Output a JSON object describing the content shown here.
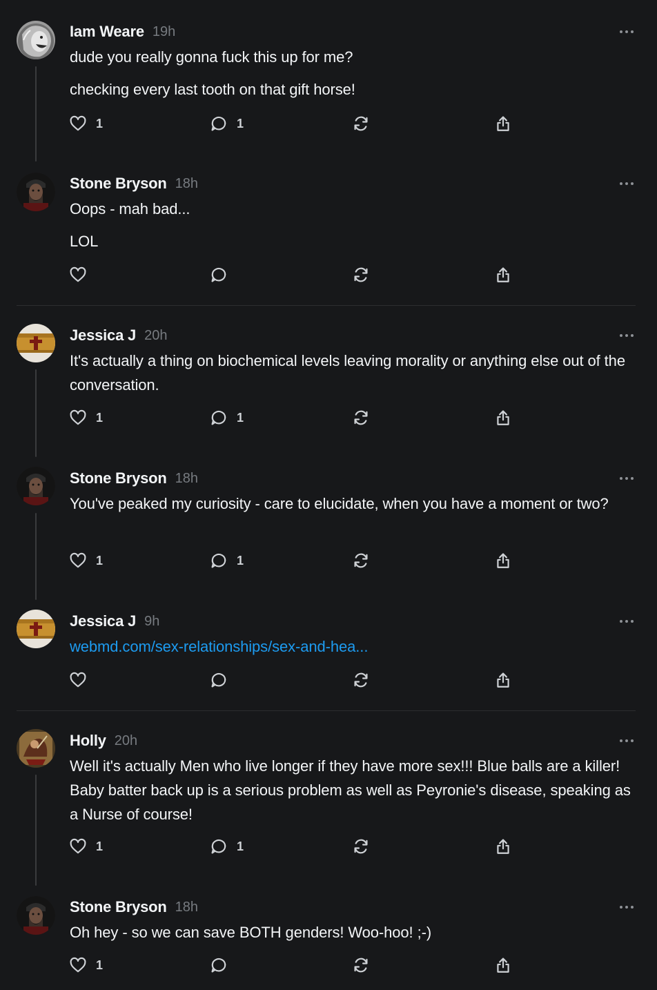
{
  "posts": [
    {
      "author": "Iam Weare",
      "time": "19h",
      "avatar": "lion-avatar",
      "paragraphs": [
        "dude you really gonna fuck this up for me?",
        "checking every last tooth on that gift horse!"
      ],
      "likes": "1",
      "replies": "1"
    },
    {
      "author": "Stone Bryson",
      "time": "18h",
      "avatar": "bearded-man-avatar",
      "paragraphs": [
        "Oops - mah bad...",
        "LOL"
      ],
      "likes": "",
      "replies": ""
    },
    {
      "author": "Jessica J",
      "time": "20h",
      "avatar": "cross-book-avatar",
      "text": "It's actually a thing on biochemical levels leaving morality or anything else out of the conversation.",
      "likes": "1",
      "replies": "1"
    },
    {
      "author": "Stone Bryson",
      "time": "18h",
      "avatar": "bearded-man-avatar",
      "text": "You've peaked my curiosity - care to elucidate, when you have a moment or two?",
      "likes": "1",
      "replies": "1"
    },
    {
      "author": "Jessica J",
      "time": "9h",
      "avatar": "cross-book-avatar",
      "link": "webmd.com/sex-relationships/sex-and-hea...",
      "likes": "",
      "replies": ""
    },
    {
      "author": "Holly",
      "time": "20h",
      "avatar": "painting-avatar",
      "text": "Well it's actually Men who live longer if they have more sex!!! Blue balls are a killer! Baby batter back up is a serious problem as well as Peyronie's disease, speaking as a Nurse of course!",
      "likes": "1",
      "replies": "1"
    },
    {
      "author": "Stone Bryson",
      "time": "18h",
      "avatar": "bearded-man-avatar",
      "text": "Oh hey - so we can save BOTH genders! Woo-hoo! ;-)",
      "likes": "1",
      "replies": ""
    }
  ],
  "icons": {
    "like": "heart-icon",
    "reply": "comment-icon",
    "repost": "repost-icon",
    "share": "share-icon",
    "more": "more-options-icon"
  },
  "colors": {
    "background": "#17181a",
    "text": "#f3f5f7",
    "muted": "#777b80",
    "link": "#1d9bf0",
    "divider": "#2d2e30"
  }
}
